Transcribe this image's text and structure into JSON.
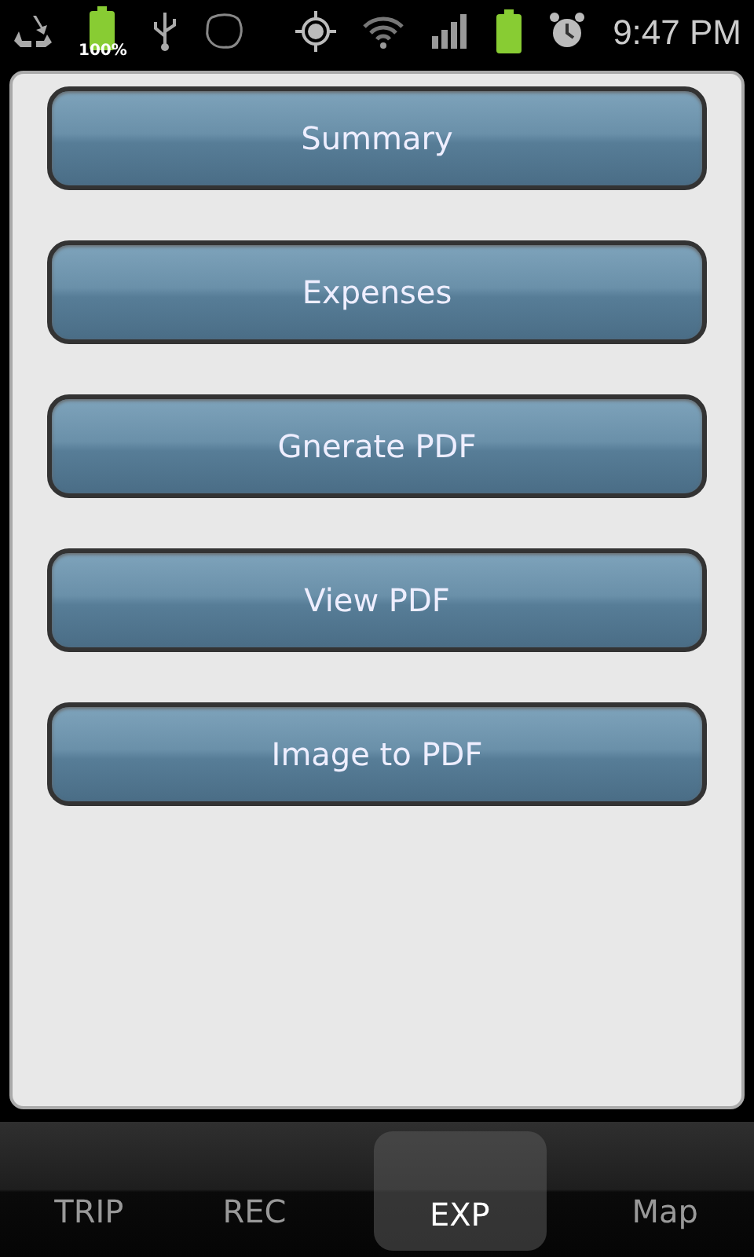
{
  "status_bar": {
    "battery_percent": "100%",
    "time": "9:47 PM"
  },
  "buttons": [
    "Summary",
    "Expenses",
    "Gnerate PDF",
    "View PDF",
    "Image to PDF"
  ],
  "tabs": [
    {
      "label": "TRIP",
      "selected": false
    },
    {
      "label": "REC",
      "selected": false
    },
    {
      "label": "EXP",
      "selected": true
    },
    {
      "label": "Map",
      "selected": false
    }
  ]
}
